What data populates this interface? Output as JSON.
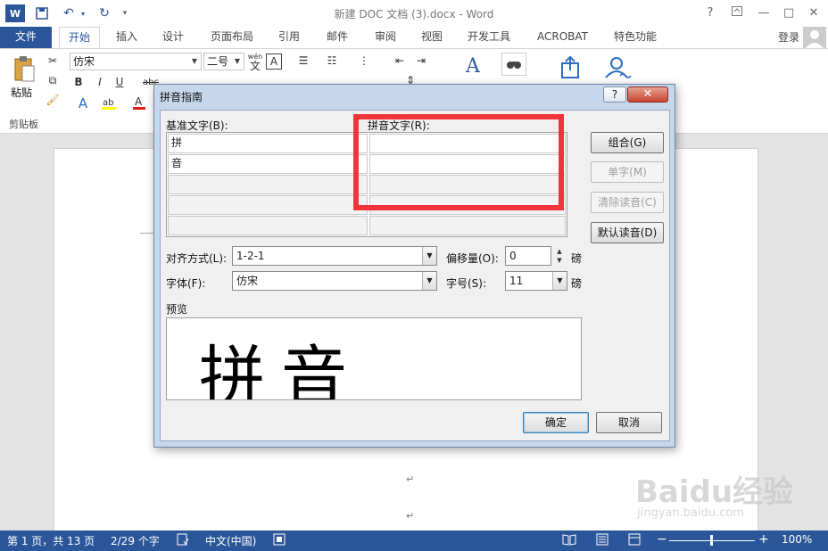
{
  "window": {
    "title": "新建 DOC 文档 (3).docx - Word",
    "help": "?",
    "minimize": "—",
    "restore": "□",
    "close": "✕"
  },
  "quick_access": {
    "word_icon": "W",
    "undo": "↶",
    "redo": "↻"
  },
  "tabs": {
    "file": "文件",
    "items": [
      "开始",
      "插入",
      "设计",
      "页面布局",
      "引用",
      "邮件",
      "审阅",
      "视图",
      "开发工具",
      "ACROBAT",
      "特色功能"
    ],
    "login": "登录"
  },
  "ribbon": {
    "paste_label": "粘贴",
    "font_name": "仿宋",
    "font_size": "二号",
    "wen": "wén",
    "wen2": "文",
    "a_box": "A",
    "bold": "B",
    "italic": "I",
    "underline": "U",
    "abc": "abc",
    "clip_group": "剪贴板"
  },
  "dialog": {
    "title": "拼音指南",
    "help": "?",
    "close": "✕",
    "base_label": "基准文字(B):",
    "ruby_label": "拼音文字(R):",
    "base_rows": [
      "拼",
      "音",
      "",
      "",
      ""
    ],
    "ruby_rows": [
      "",
      "",
      "",
      "",
      ""
    ],
    "buttons": {
      "group": "组合(G)",
      "mono": "单字(M)",
      "clear": "清除读音(C)",
      "default": "默认读音(D)",
      "ok": "确定",
      "cancel": "取消"
    },
    "align_label": "对齐方式(L):",
    "align_value": "1-2-1",
    "offset_label": "偏移量(O):",
    "offset_value": "0",
    "offset_unit": "磅",
    "font_label": "字体(F):",
    "font_value": "仿宋",
    "size_label": "字号(S):",
    "size_value": "11",
    "size_unit": "磅",
    "preview_label": "预览",
    "preview_text": "拼音"
  },
  "document": {
    "para_mark": "↵"
  },
  "status": {
    "page": "第 1 页，共 13 页",
    "words": "2/29 个字",
    "lang": "中文(中国)",
    "minus": "−",
    "plus": "+",
    "zoom": "100%"
  },
  "watermark": {
    "brand": "Baidu经验",
    "url": "jingyan.baidu.com"
  },
  "colors": {
    "accent": "#2b579a",
    "highlight": "#f2343a"
  }
}
